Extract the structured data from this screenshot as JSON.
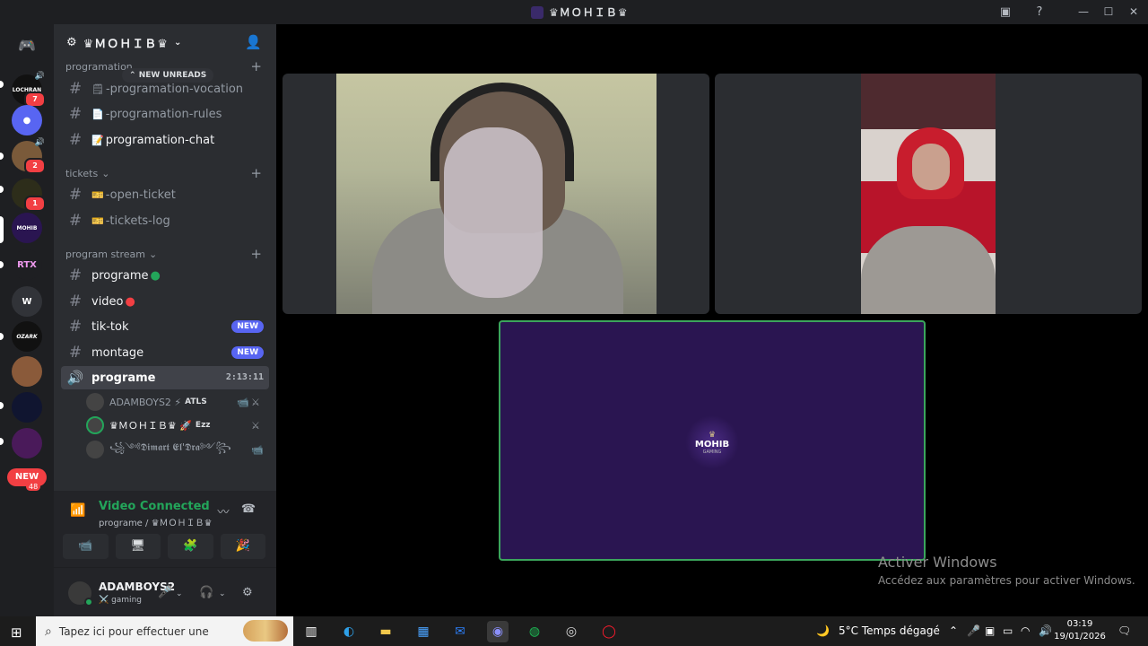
{
  "window": {
    "title": "♛ＭＯＨＩＢ♛"
  },
  "titlebar": {
    "inbox_icon": "inbox-icon",
    "help_icon": "help-icon"
  },
  "server_rail": {
    "items": [
      {
        "label": "LOCHRAN",
        "badge": "7"
      },
      {
        "label": "●",
        "badge": ""
      },
      {
        "label": "",
        "badge": "2"
      },
      {
        "label": "",
        "badge": "1"
      },
      {
        "label": "MOHIB",
        "badge": ""
      },
      {
        "label": "RTX",
        "badge": ""
      },
      {
        "label": "W",
        "badge": ""
      },
      {
        "label": "OZARK",
        "badge": ""
      },
      {
        "label": "",
        "badge": ""
      },
      {
        "label": "",
        "badge": ""
      },
      {
        "label": "",
        "badge": ""
      }
    ],
    "new_label": "NEW",
    "new_count": "48"
  },
  "guild": {
    "name": "♛ＭＯＨＩＢ♛",
    "unreads_pill": "NEW UNREADS",
    "categories": {
      "programation": "programation",
      "tickets": "tickets",
      "program_stream": "program stream"
    },
    "channels": {
      "vocation": "-programation-vocation",
      "rules": "-programation-rules",
      "chat": "programation-chat",
      "open_ticket": "-open-ticket",
      "tickets_log": "-tickets-log",
      "programe": "programe",
      "video": "video",
      "tiktok": "tik-tok",
      "montage": "montage",
      "voice_programe": "programe"
    },
    "new_tag": "NEW",
    "voice_timer": "2:13:11",
    "voice_users": [
      {
        "name": "ADAMBOYS2 ⚡",
        "tag": "ATLS"
      },
      {
        "name": "♛ＭＯＨＩＢ♛ 🚀",
        "tag": "Ezz"
      },
      {
        "name": "꧁༺𝕯𝖎𝖒𝖆𝖗𝖙 𝕰𝖑'𝕯𝖗𝖆༻꧂",
        "tag": ""
      }
    ]
  },
  "voice_panel": {
    "title": "Video Connected",
    "subtitle": "programe / ♛ＭＯＨＩＢ♛"
  },
  "user_panel": {
    "name": "ADAMBOYS2",
    "status": "⚔️ gaming"
  },
  "stage": {
    "logo_title": "MOHIB",
    "logo_sub": "GAMING"
  },
  "watermark": {
    "title": "Activer Windows",
    "subtitle": "Accédez aux paramètres pour activer Windows."
  },
  "taskbar": {
    "search_placeholder": "Tapez ici pour effectuer une",
    "weather": "5°C  Temps dégagé",
    "time": "03:19",
    "date": "19/01/2026"
  },
  "colors": {
    "accent_green": "#23a55a",
    "badge_red": "#f23f43",
    "blurple": "#5865f2",
    "stage_purple": "#2a1551"
  }
}
